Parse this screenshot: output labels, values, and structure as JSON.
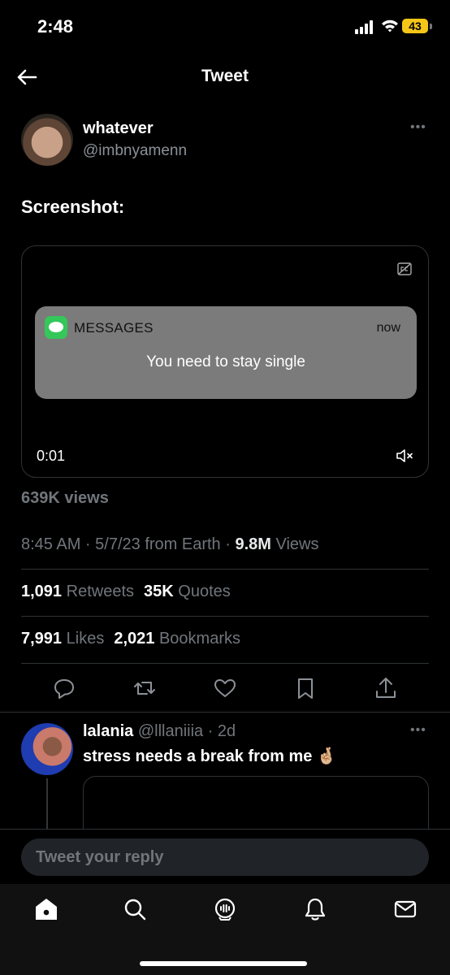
{
  "status_bar": {
    "time": "2:48",
    "battery": "43"
  },
  "header": {
    "title": "Tweet"
  },
  "tweet": {
    "author_name": "whatever",
    "author_handle": "@imbnyamenn",
    "text": "Screenshot:",
    "media": {
      "notification_app": "MESSAGES",
      "notification_time": "now",
      "notification_body": "You need to stay single",
      "video_time": "0:01"
    },
    "views_label": "639K views",
    "meta": {
      "timestamp": "8:45 AM · 5/7/23 from Earth · ",
      "views_count": "9.8M",
      "views_suffix": " Views"
    },
    "stats": {
      "retweets_count": "1,091",
      "retweets_label": "Retweets",
      "quotes_count": "35K",
      "quotes_label": "Quotes",
      "likes_count": "7,991",
      "likes_label": "Likes",
      "bookmarks_count": "2,021",
      "bookmarks_label": "Bookmarks"
    }
  },
  "reply": {
    "author_name": "lalania",
    "author_handle_time": "@lllaniiia · 2d",
    "text": "stress needs a break from me 🤞🏼"
  },
  "reply_bar": {
    "placeholder": "Tweet your reply"
  },
  "icons": [
    "back-arrow-icon",
    "more-icon",
    "captions-icon",
    "mute-icon",
    "reply-icon",
    "retweet-icon",
    "like-icon",
    "bookmark-icon",
    "share-icon",
    "home-icon",
    "search-icon",
    "spaces-icon",
    "notifications-icon",
    "messages-icon"
  ],
  "colors": {
    "background": "#000000",
    "secondary_text": "#71767b",
    "divider": "#2f3336",
    "messages_green": "#34c759",
    "battery": "#f5c518"
  }
}
